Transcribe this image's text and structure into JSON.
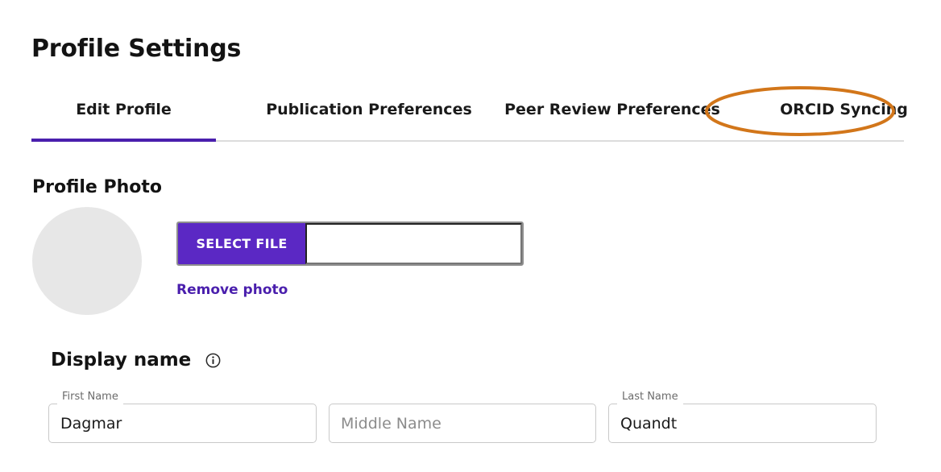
{
  "page": {
    "title": "Profile Settings"
  },
  "tabs": {
    "items": [
      {
        "label": "Edit Profile",
        "active": true
      },
      {
        "label": "Publication Preferences",
        "active": false
      },
      {
        "label": "Peer Review Preferences",
        "active": false
      },
      {
        "label": "ORCID Syncing",
        "active": false
      }
    ],
    "active_index": 0,
    "active_underline_color": "#4a1fad",
    "rule_color": "#dcdcdc"
  },
  "annotation": {
    "shape": "ellipse",
    "target": "ORCID Syncing",
    "color": "#d2761a",
    "stroke_width": 4
  },
  "profile_photo": {
    "heading": "Profile Photo",
    "avatar": {
      "icon": "avatar-placeholder",
      "fill": "#e7e7e7"
    },
    "select_file_label": "SELECT FILE",
    "select_file_color": "#5b28c4",
    "file_name_value": "",
    "file_name_placeholder": "",
    "remove_photo_label": "Remove photo",
    "remove_photo_color": "#4a1fad"
  },
  "display_name": {
    "heading": "Display name",
    "info_icon": "info-circle-icon",
    "fields": [
      {
        "label": "First Name",
        "value": "Dagmar",
        "placeholder": "",
        "has_floating_label": true
      },
      {
        "label": "",
        "value": "",
        "placeholder": "Middle Name",
        "has_floating_label": false
      },
      {
        "label": "Last Name",
        "value": "Quandt",
        "placeholder": "",
        "has_floating_label": true
      }
    ]
  }
}
